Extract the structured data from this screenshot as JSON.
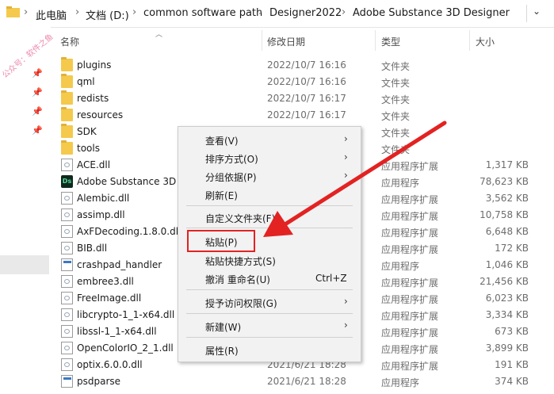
{
  "breadcrumb": [
    "此电脑",
    "文档 (D:)",
    "common software path",
    "Designer2022",
    "Adobe Substance 3D Designer"
  ],
  "watermark": "公众号：软件之鱼",
  "columns": {
    "name": "名称",
    "date": "修改日期",
    "type": "类型",
    "size": "大小"
  },
  "files": [
    {
      "name": "plugins",
      "date": "2022/10/7 16:16",
      "type": "文件夹",
      "size": "",
      "icon": "folder-icon"
    },
    {
      "name": "qml",
      "date": "2022/10/7 16:16",
      "type": "文件夹",
      "size": "",
      "icon": "folder-icon"
    },
    {
      "name": "redists",
      "date": "2022/10/7 16:17",
      "type": "文件夹",
      "size": "",
      "icon": "folder-icon"
    },
    {
      "name": "resources",
      "date": "2022/10/7 16:17",
      "type": "文件夹",
      "size": "",
      "icon": "folder-icon"
    },
    {
      "name": "SDK",
      "date": "",
      "type": "文件夹",
      "size": "",
      "icon": "folder-icon"
    },
    {
      "name": "tools",
      "date": "",
      "type": "文件夹",
      "size": "",
      "icon": "folder-icon"
    },
    {
      "name": "ACE.dll",
      "date": "",
      "type": "应用程序扩展",
      "size": "1,317 KB",
      "icon": "dll-icon"
    },
    {
      "name": "Adobe Substance 3D",
      "date": "",
      "type": "应用程序",
      "size": "78,623 KB",
      "icon": "designer-app-icon"
    },
    {
      "name": "Alembic.dll",
      "date": "",
      "type": "应用程序扩展",
      "size": "3,562 KB",
      "icon": "dll-icon"
    },
    {
      "name": "assimp.dll",
      "date": "",
      "type": "应用程序扩展",
      "size": "10,758 KB",
      "icon": "dll-icon"
    },
    {
      "name": "AxFDecoding.1.8.0.dll",
      "date": "",
      "type": "应用程序扩展",
      "size": "6,648 KB",
      "icon": "dll-icon"
    },
    {
      "name": "BIB.dll",
      "date": "",
      "type": "应用程序扩展",
      "size": "172 KB",
      "icon": "dll-icon"
    },
    {
      "name": "crashpad_handler",
      "date": "",
      "type": "应用程序",
      "size": "1,046 KB",
      "icon": "exe-icon"
    },
    {
      "name": "embree3.dll",
      "date": "",
      "type": "应用程序扩展",
      "size": "21,456 KB",
      "icon": "dll-icon"
    },
    {
      "name": "FreeImage.dll",
      "date": "",
      "type": "应用程序扩展",
      "size": "6,023 KB",
      "icon": "dll-icon"
    },
    {
      "name": "libcrypto-1_1-x64.dll",
      "date": "",
      "type": "应用程序扩展",
      "size": "3,334 KB",
      "icon": "dll-icon"
    },
    {
      "name": "libssl-1_1-x64.dll",
      "date": "",
      "type": "应用程序扩展",
      "size": "673 KB",
      "icon": "dll-icon"
    },
    {
      "name": "OpenColorIO_2_1.dll",
      "date": "",
      "type": "应用程序扩展",
      "size": "3,899 KB",
      "icon": "dll-icon"
    },
    {
      "name": "optix.6.0.0.dll",
      "date": "2021/6/21 18:28",
      "type": "应用程序扩展",
      "size": "191 KB",
      "icon": "dll-icon"
    },
    {
      "name": "psdparse",
      "date": "2021/6/21 18:28",
      "type": "应用程序",
      "size": "374 KB",
      "icon": "exe-icon"
    }
  ],
  "context_menu": {
    "view": "查看(V)",
    "sort": "排序方式(O)",
    "group": "分组依据(P)",
    "refresh": "刷新(E)",
    "customize": "自定义文件夹(F)...",
    "paste": "粘贴(P)",
    "paste_shortcut": "粘贴快捷方式(S)",
    "undo_rename": "撤消 重命名(U)",
    "undo_shortcut": "Ctrl+Z",
    "grant_access": "授予访问权限(G)",
    "new": "新建(W)",
    "properties": "属性(R)"
  },
  "colors": {
    "highlight": "#e32222",
    "arrow": "#e32222",
    "folder": "#f4c94c"
  }
}
